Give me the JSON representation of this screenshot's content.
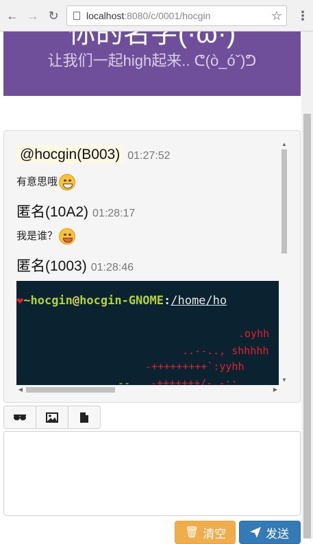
{
  "browser": {
    "url_host": "localhost",
    "url_path": ":8080/c/0001/hocgin"
  },
  "banner": {
    "title_clipped": "你的名字(·ω·)",
    "subtitle": "让我们一起high起来.. ᕦ(ò_óˇ)ᕤ"
  },
  "messages": [
    {
      "name": "@hocgin(B003)",
      "time": "01:27:52",
      "text": "有意思哦",
      "emoji": "grinning-face-emoji"
    },
    {
      "name": "匿名(10A2)",
      "time": "01:28:17",
      "text": "我是谁？",
      "emoji": "winking-tongue-emoji"
    },
    {
      "name": "匿名(1003)",
      "time": "01:28:46"
    }
  ],
  "terminal": {
    "heart": "❤",
    "user": "~hocgin",
    "at": "@",
    "host": "hocgin-GNOME",
    "colon": ":",
    "path": "/home/ho",
    "art": [
      ".oyhh",
      "..--.., shhhhh",
      "-+++++++++`:yyhh",
      "-+++++++/-.-::",
      "--"
    ]
  },
  "toolbar": {
    "icons": [
      "sunglasses-icon",
      "image-icon",
      "file-icon"
    ]
  },
  "input": {
    "value": "",
    "placeholder": ""
  },
  "buttons": {
    "clear_label": "清空",
    "send_label": "发送"
  },
  "colors": {
    "banner": "#6f4f99",
    "clear": "#f0ad4e",
    "send": "#337ab7"
  }
}
